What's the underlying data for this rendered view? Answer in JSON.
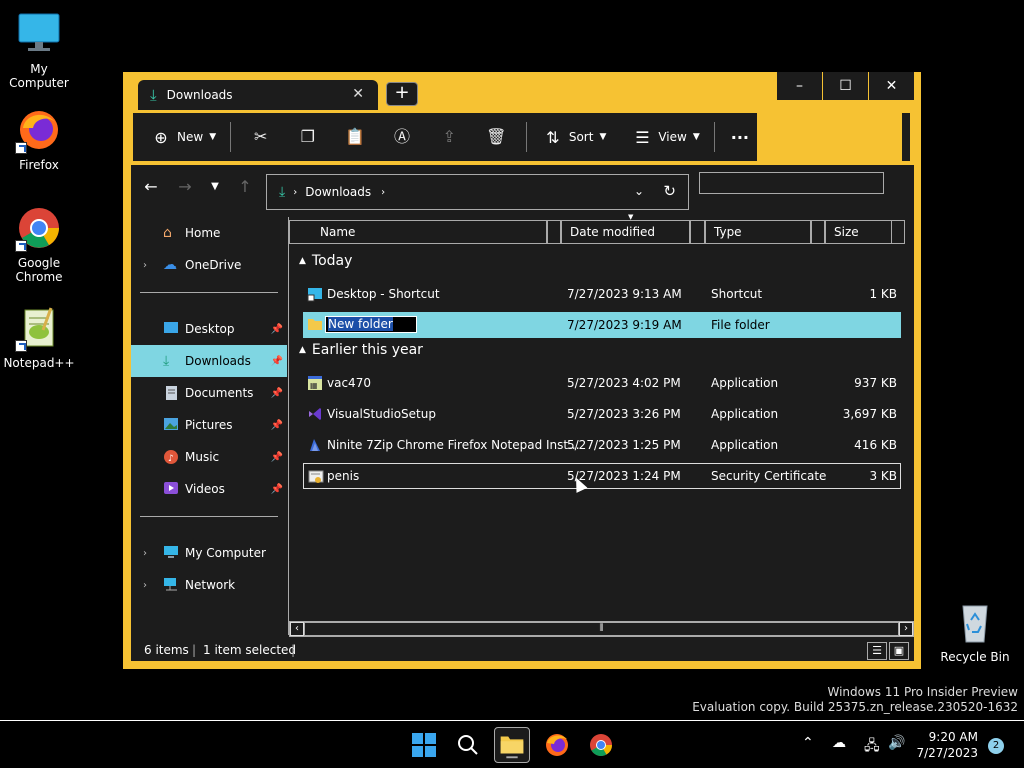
{
  "desktop": {
    "icons": [
      {
        "label": "My Computer"
      },
      {
        "label": "Firefox"
      },
      {
        "label": "Google Chrome"
      },
      {
        "label": "Notepad++"
      },
      {
        "label": "Recycle Bin"
      }
    ]
  },
  "window": {
    "tab_title": "Downloads",
    "new_tab": "+",
    "controls": {
      "minimize": "–",
      "maximize": "☐",
      "close": "✕"
    }
  },
  "toolbar": {
    "new_label": "New",
    "sort_label": "Sort",
    "view_label": "View",
    "more_label": "···"
  },
  "address": {
    "path": "Downloads",
    "search_placeholder": ""
  },
  "sidebar": {
    "items": [
      {
        "label": "Home"
      },
      {
        "label": "OneDrive"
      },
      {
        "label": "Desktop"
      },
      {
        "label": "Downloads"
      },
      {
        "label": "Documents"
      },
      {
        "label": "Pictures"
      },
      {
        "label": "Music"
      },
      {
        "label": "Videos"
      },
      {
        "label": "My Computer"
      },
      {
        "label": "Network"
      }
    ]
  },
  "columns": {
    "name": "Name",
    "date": "Date modified",
    "type": "Type",
    "size": "Size"
  },
  "groups": {
    "today": "Today",
    "earlier": "Earlier this year"
  },
  "files": [
    {
      "name": "Desktop - Shortcut",
      "date": "7/27/2023 9:13 AM",
      "type": "Shortcut",
      "size": "1 KB"
    },
    {
      "name": "New folder",
      "date": "7/27/2023 9:19 AM",
      "type": "File folder",
      "size": ""
    },
    {
      "name": "vac470",
      "date": "5/27/2023 4:02 PM",
      "type": "Application",
      "size": "937 KB"
    },
    {
      "name": "VisualStudioSetup",
      "date": "5/27/2023 3:26 PM",
      "type": "Application",
      "size": "3,697 KB"
    },
    {
      "name": "Ninite 7Zip Chrome Firefox Notepad Inst...",
      "date": "5/27/2023 1:25 PM",
      "type": "Application",
      "size": "416 KB"
    },
    {
      "name": "penis",
      "date": "5/27/2023 1:24 PM",
      "type": "Security Certificate",
      "size": "3 KB"
    }
  ],
  "status": {
    "count": "6 items",
    "selected": "1 item selected"
  },
  "watermark": {
    "line1": "Windows 11 Pro Insider Preview",
    "line2": "Evaluation copy. Build 25375.zn_release.230520-1632"
  },
  "taskbar": {
    "time": "9:20 AM",
    "date": "7/27/2023",
    "notifications": "2"
  },
  "colors": {
    "window_frame": "#f6c233",
    "selection": "#7fd6e2",
    "panel": "#1c1c1c"
  }
}
